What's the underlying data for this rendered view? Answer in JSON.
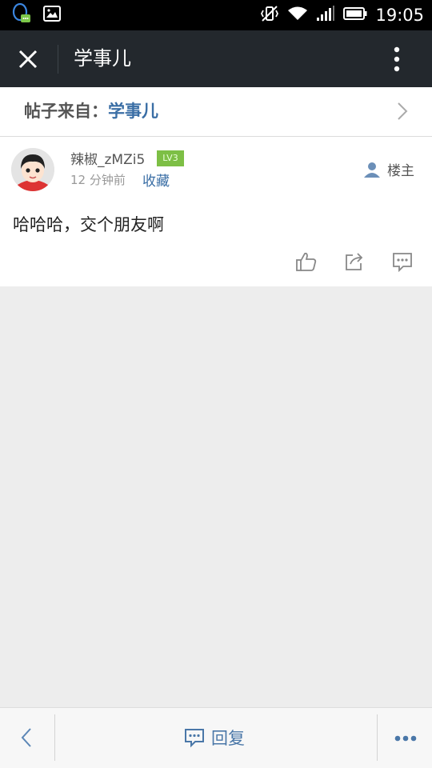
{
  "status_bar": {
    "time": "19:05",
    "left_icons": [
      "qq-notification-icon",
      "image-notification-icon"
    ],
    "right_icons": [
      "mute-vibrate-icon",
      "wifi-icon",
      "signal-icon",
      "battery-icon"
    ]
  },
  "title_bar": {
    "title": "学事儿",
    "close_icon": "close-icon",
    "more_icon": "vertical-dots-icon"
  },
  "source": {
    "prefix": "帖子来自：",
    "name": "学事儿"
  },
  "post": {
    "author": "辣椒_zMZi5",
    "level": "LV3",
    "time": "12 分钟前",
    "favorite_label": "收藏",
    "op_label": "楼主",
    "content": "哈哈哈，交个朋友啊",
    "actions": [
      "thumbs-up-icon",
      "share-icon",
      "comment-icon"
    ]
  },
  "bottom_bar": {
    "reply_label": "回复",
    "back_icon": "chevron-left-icon",
    "more_icon": "horizontal-dots-icon"
  },
  "colors": {
    "accent_blue": "#3a6ea5",
    "title_bar_bg": "#23282d",
    "level_badge_green": "#7dbf45",
    "page_bg": "#ededed"
  }
}
